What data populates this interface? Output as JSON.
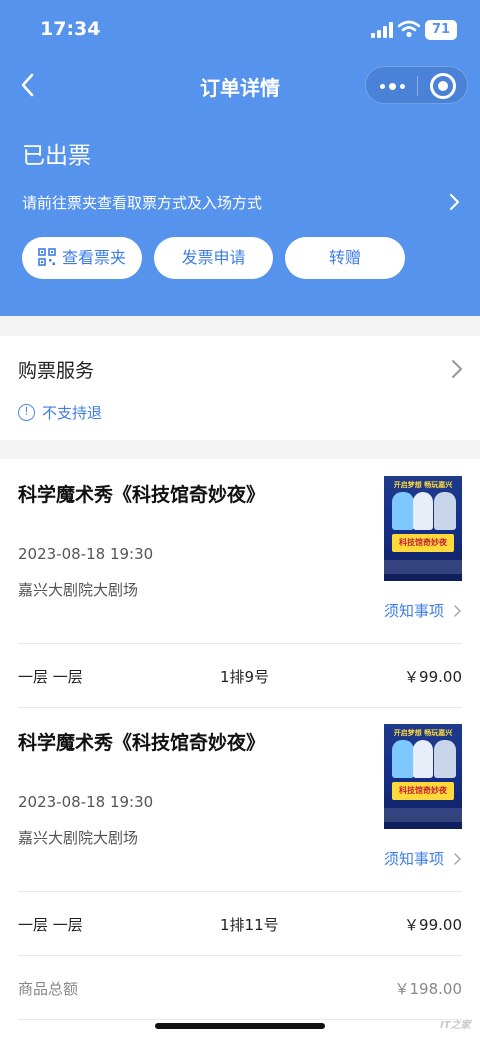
{
  "status_bar": {
    "time": "17:34",
    "battery": "71"
  },
  "nav": {
    "title": "订单详情"
  },
  "order": {
    "status": "已出票",
    "ticket_hint": "请前往票夹查看取票方式及入场方式",
    "actions": {
      "wallet": "查看票夹",
      "invoice": "发票申请",
      "gift": "转赠"
    }
  },
  "service": {
    "title": "购票服务",
    "refund_policy": "不支持退"
  },
  "tickets": [
    {
      "title": "科学魔术秀《科技馆奇妙夜》",
      "datetime": "2023-08-18 19:30",
      "venue": "嘉兴大剧院大剧场",
      "notice": "须知事项",
      "seat_level": "一层 一层",
      "seat": "1排9号",
      "price": "￥99.00"
    },
    {
      "title": "科学魔术秀《科技馆奇妙夜》",
      "datetime": "2023-08-18 19:30",
      "venue": "嘉兴大剧院大剧场",
      "notice": "须知事项",
      "seat_level": "一层 一层",
      "seat": "1排11号",
      "price": "￥99.00"
    }
  ],
  "poster": {
    "top_text": "开启梦想 畅玩嘉兴",
    "band_text": "科技馆奇妙夜"
  },
  "summary": {
    "label": "商品总额",
    "value": "￥198.00"
  },
  "watermark": "IT之家",
  "colors": {
    "header": "#5693ec",
    "accent": "#3d7de6"
  }
}
